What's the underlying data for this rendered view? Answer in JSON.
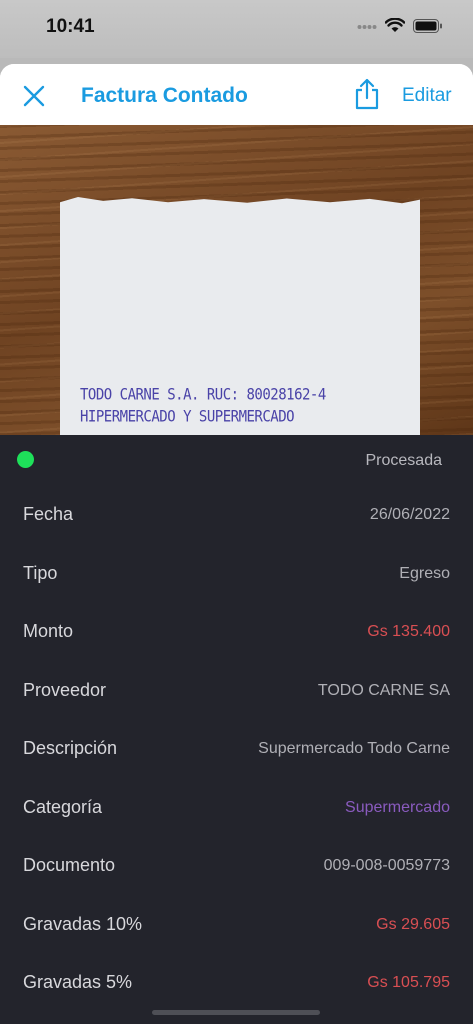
{
  "status_bar": {
    "time": "10:41"
  },
  "nav": {
    "title": "Factura Contado",
    "edit_label": "Editar"
  },
  "receipt_image": {
    "lines": [
      "TODO CARNE S.A.       RUC: 80028162-4",
      "HIPERMERCADO Y SUPERMERCADO"
    ]
  },
  "status": {
    "label": "Procesada",
    "color": "#1ee05a"
  },
  "fields": [
    {
      "label": "Fecha",
      "value": "26/06/2022",
      "tone": "normal"
    },
    {
      "label": "Tipo",
      "value": "Egreso",
      "tone": "normal"
    },
    {
      "label": "Monto",
      "value": "Gs 135.400",
      "tone": "red"
    },
    {
      "label": "Proveedor",
      "value": "TODO CARNE SA",
      "tone": "normal"
    },
    {
      "label": "Descripción",
      "value": "Supermercado Todo Carne",
      "tone": "normal"
    },
    {
      "label": "Categoría",
      "value": "Supermercado",
      "tone": "purple"
    },
    {
      "label": "Documento",
      "value": "009-008-0059773",
      "tone": "normal"
    },
    {
      "label": "Gravadas 10%",
      "value": "Gs 29.605",
      "tone": "red"
    },
    {
      "label": "Gravadas 5%",
      "value": "Gs 105.795",
      "tone": "red"
    }
  ],
  "colors": {
    "accent": "#1a9be0",
    "red": "#d94f53",
    "purple": "#8a5bbf",
    "panel": "#23242c"
  }
}
